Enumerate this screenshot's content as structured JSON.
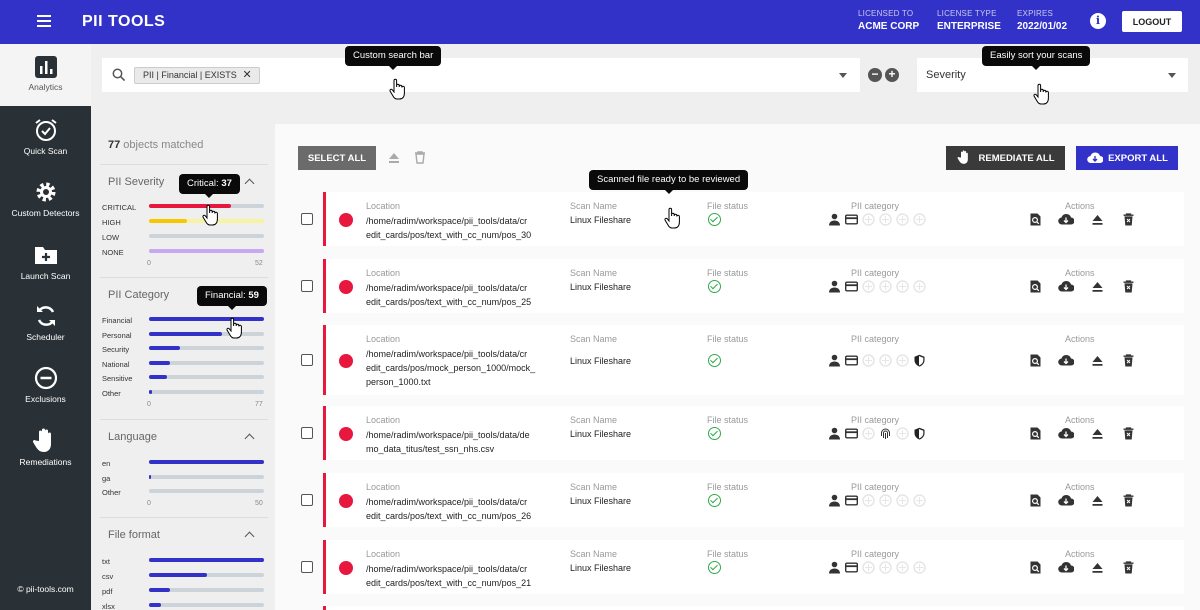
{
  "app": {
    "title": "PII TOOLS",
    "logout_label": "LOGOUT",
    "info_glyph": "i"
  },
  "license": [
    {
      "label": "LICENSED TO",
      "value": "ACME CORP"
    },
    {
      "label": "LICENSE TYPE",
      "value": "ENTERPRISE"
    },
    {
      "label": "EXPIRES",
      "value": "2022/01/02"
    }
  ],
  "sidebar": {
    "items": [
      {
        "label": "Analytics",
        "icon": "bar-chart-icon",
        "active": true
      },
      {
        "label": "Quick Scan",
        "icon": "alarm-clock-icon"
      },
      {
        "label": "Custom Detectors",
        "icon": "gear-icon"
      },
      {
        "label": "Launch Scan",
        "icon": "folder-plus-icon"
      },
      {
        "label": "Scheduler",
        "icon": "sync-icon"
      },
      {
        "label": "Exclusions",
        "icon": "minus-circle-icon"
      },
      {
        "label": "Remediations",
        "icon": "hand-icon"
      }
    ],
    "copyright": "© pii-tools.com"
  },
  "search": {
    "query_chip": "PII | Financial | EXISTS",
    "chip_close": "✕",
    "minus": "−",
    "plus": "+"
  },
  "sort": {
    "selected": "Severity"
  },
  "tooltips": {
    "search": "Custom search bar",
    "sort": "Easily sort your scans",
    "scanned": "Scanned file ready to be reviewed",
    "critical_label": "Critical: ",
    "critical_value": "37",
    "financial_label": "Financial: ",
    "financial_value": "59"
  },
  "filters": {
    "matched_count": "77",
    "matched_text": " objects matched",
    "groups": [
      {
        "title": "PII Severity",
        "axis": [
          "0",
          "52"
        ],
        "rows": [
          {
            "label": "CRITICAL",
            "value": 37,
            "max": 52,
            "color": "#e8173d"
          },
          {
            "label": "HIGH",
            "value": 17,
            "max": 52,
            "color": "#f5c800",
            "bg": "#f7f3a0"
          },
          {
            "label": "LOW",
            "value": 0,
            "max": 52,
            "color": "#aaaaaa"
          },
          {
            "label": "NONE",
            "value": 52,
            "max": 52,
            "color": "#c8a8f0"
          }
        ]
      },
      {
        "title": "PII Category",
        "axis": [
          "0",
          "77"
        ],
        "rows": [
          {
            "label": "Financial",
            "value": 77,
            "max": 77,
            "color": "#3232c8"
          },
          {
            "label": "Personal",
            "value": 49,
            "max": 77,
            "color": "#3232c8"
          },
          {
            "label": "Security",
            "value": 21,
            "max": 77,
            "color": "#3232c8"
          },
          {
            "label": "National",
            "value": 14,
            "max": 77,
            "color": "#3232c8"
          },
          {
            "label": "Sensitive",
            "value": 12,
            "max": 77,
            "color": "#3232c8"
          },
          {
            "label": "Other",
            "value": 2,
            "max": 77,
            "color": "#3232c8"
          }
        ]
      },
      {
        "title": "Language",
        "axis": [
          "0",
          "50"
        ],
        "rows": [
          {
            "label": "en",
            "value": 50,
            "max": 50,
            "color": "#3232c8"
          },
          {
            "label": "ga",
            "value": 1,
            "max": 50,
            "color": "#3232c8"
          },
          {
            "label": "Other",
            "value": 0,
            "max": 50,
            "color": "#3232c8"
          }
        ]
      },
      {
        "title": "File format",
        "axis": [],
        "rows": [
          {
            "label": "txt",
            "value": 100,
            "max": 100,
            "color": "#3232c8"
          },
          {
            "label": "csv",
            "value": 50,
            "max": 100,
            "color": "#3232c8"
          },
          {
            "label": "pdf",
            "value": 18,
            "max": 100,
            "color": "#3232c8"
          },
          {
            "label": "xlsx",
            "value": 10,
            "max": 100,
            "color": "#3232c8"
          }
        ]
      }
    ]
  },
  "toolbar": {
    "select_all": "SELECT ALL",
    "remediate_all": "REMEDIATE ALL",
    "export_all": "EXPORT ALL"
  },
  "columns": {
    "location": "Location",
    "scan_name": "Scan Name",
    "file_status": "File status",
    "pii_category": "PII category",
    "actions": "Actions"
  },
  "results": [
    {
      "location": [
        "/home/radim/workspace/pii_tools/data/cr",
        "edit_cards/pos/text_with_cc_num/pos_30"
      ],
      "scan_name": "Linux Fileshare",
      "icons": [
        "person",
        "card",
        "x",
        "x",
        "x",
        "x"
      ]
    },
    {
      "location": [
        "/home/radim/workspace/pii_tools/data/cr",
        "edit_cards/pos/text_with_cc_num/pos_25"
      ],
      "scan_name": "Linux Fileshare",
      "icons": [
        "person",
        "card",
        "x",
        "x",
        "x",
        "x"
      ]
    },
    {
      "location": [
        "/home/radim/workspace/pii_tools/data/cr",
        "edit_cards/pos/mock_person_1000/mock_",
        "person_1000.txt"
      ],
      "scan_name": "Linux Fileshare",
      "icons": [
        "person",
        "card",
        "x",
        "x",
        "x",
        "shield"
      ]
    },
    {
      "location": [
        "/home/radim/workspace/pii_tools/data/de",
        "mo_data_titus/test_ssn_nhs.csv"
      ],
      "scan_name": "Linux Fileshare",
      "icons": [
        "person",
        "card",
        "x",
        "finger",
        "x",
        "shield"
      ]
    },
    {
      "location": [
        "/home/radim/workspace/pii_tools/data/cr",
        "edit_cards/pos/text_with_cc_num/pos_26"
      ],
      "scan_name": "Linux Fileshare",
      "icons": [
        "person",
        "card",
        "x",
        "x",
        "x",
        "x"
      ]
    },
    {
      "location": [
        "/home/radim/workspace/pii_tools/data/cr",
        "edit_cards/pos/text_with_cc_num/pos_21"
      ],
      "scan_name": "Linux Fileshare",
      "icons": [
        "person",
        "card",
        "x",
        "x",
        "x",
        "x"
      ]
    }
  ]
}
